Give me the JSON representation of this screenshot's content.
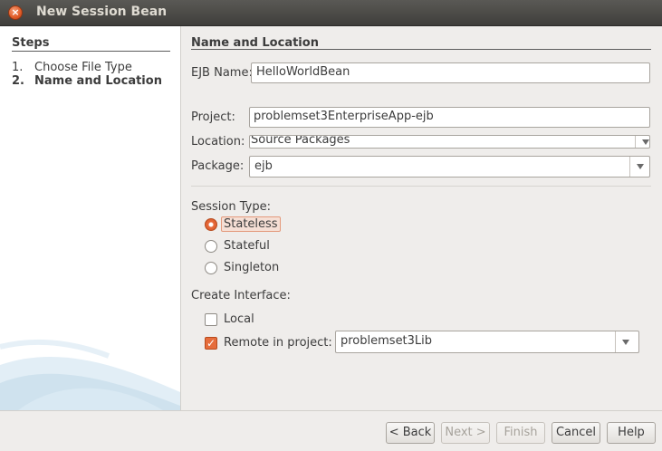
{
  "window": {
    "title": "New Session Bean"
  },
  "steps": {
    "title": "Steps",
    "items": [
      {
        "num": "1.",
        "label": "Choose File Type"
      },
      {
        "num": "2.",
        "label": "Name and Location"
      }
    ]
  },
  "form": {
    "section_title": "Name and Location",
    "ejb_name": {
      "label": "EJB Name:",
      "value": "HelloWorldBean"
    },
    "project": {
      "label": "Project:",
      "value": "problemset3EnterpriseApp-ejb"
    },
    "location": {
      "label": "Location:",
      "value": "Source Packages"
    },
    "package": {
      "label": "Package:",
      "value": "ejb"
    },
    "session_type": {
      "label": "Session Type:",
      "options": [
        "Stateless",
        "Stateful",
        "Singleton"
      ],
      "selected": "Stateless"
    },
    "create_interface": {
      "label": "Create Interface:",
      "local": {
        "label": "Local",
        "checked": false
      },
      "remote": {
        "label": "Remote in project:",
        "checked": true,
        "value": "problemset3Lib"
      }
    }
  },
  "buttons": {
    "back": "< Back",
    "next": "Next >",
    "finish": "Finish",
    "cancel": "Cancel",
    "help": "Help"
  },
  "colors": {
    "accent": "#e66d3c",
    "titlebar": "#4a4946"
  }
}
